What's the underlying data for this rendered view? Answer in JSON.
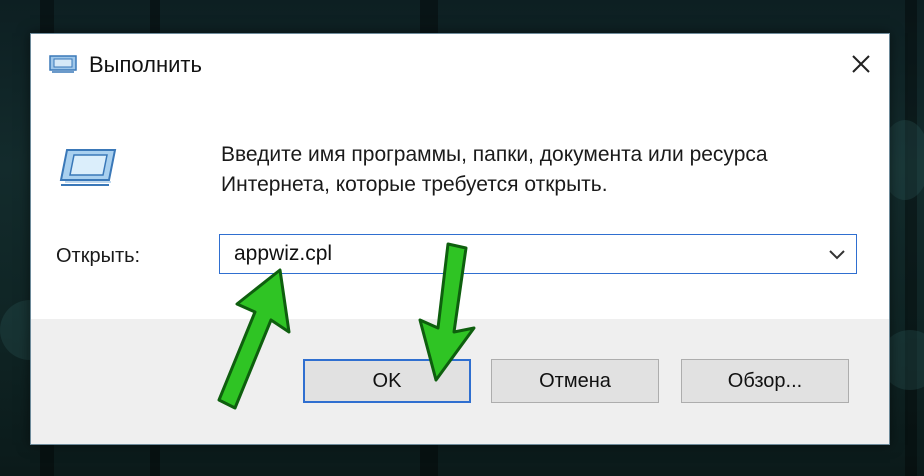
{
  "window": {
    "title": "Выполнить",
    "close_glyph": "✕"
  },
  "main": {
    "description": "Введите имя программы, папки, документа или ресурса Интернета, которые требуется открыть.",
    "open_label": "Открыть:",
    "open_value": "appwiz.cpl"
  },
  "buttons": {
    "ok": "OK",
    "cancel": "Отмена",
    "browse": "Обзор..."
  },
  "colors": {
    "accent": "#2f6fd0",
    "arrow": "#2fc424"
  },
  "icons": [
    "run-icon",
    "close-icon",
    "chevron-down-icon",
    "green-arrow-icon"
  ]
}
